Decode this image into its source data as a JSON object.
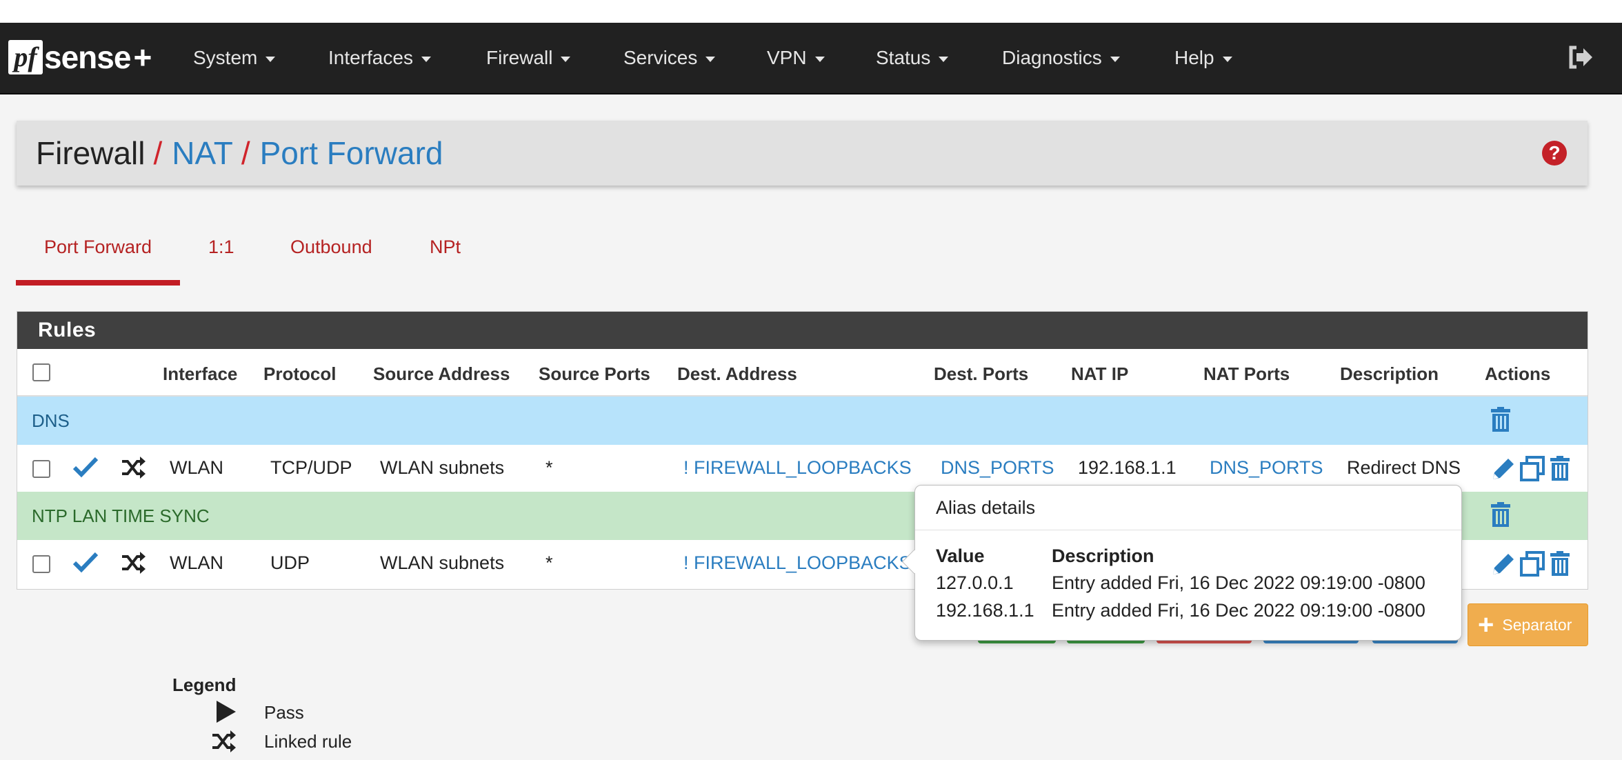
{
  "brand": {
    "pf": "pf",
    "name": "sense",
    "plus": "+"
  },
  "nav": {
    "items": [
      "System",
      "Interfaces",
      "Firewall",
      "Services",
      "VPN",
      "Status",
      "Diagnostics",
      "Help"
    ]
  },
  "breadcrumb": {
    "part1": "Firewall",
    "sep": "/",
    "part2": "NAT",
    "part3": "Port Forward",
    "help": "?"
  },
  "tabs": [
    "Port Forward",
    "1:1",
    "Outbound",
    "NPt"
  ],
  "rules": {
    "title": "Rules",
    "columns": [
      "Interface",
      "Protocol",
      "Source Address",
      "Source Ports",
      "Dest. Address",
      "Dest. Ports",
      "NAT IP",
      "NAT Ports",
      "Description",
      "Actions"
    ],
    "separators": [
      "DNS",
      "NTP LAN TIME SYNC"
    ],
    "rows": [
      {
        "interface": "WLAN",
        "protocol": "TCP/UDP",
        "source_address": "WLAN subnets",
        "source_ports": "*",
        "dest_address": "! FIREWALL_LOOPBACKS",
        "dest_ports": "DNS_PORTS",
        "nat_ip": "192.168.1.1",
        "nat_ports": "DNS_PORTS",
        "description": "Redirect DNS"
      },
      {
        "interface": "WLAN",
        "protocol": "UDP",
        "source_address": "WLAN subnets",
        "source_ports": "*",
        "dest_address": "! FIREWALL_LOOPBACKS"
      }
    ]
  },
  "popover": {
    "title": "Alias details",
    "col_value": "Value",
    "col_description": "Description",
    "entries": [
      {
        "value": "127.0.0.1",
        "description": "Entry added Fri, 16 Dec 2022 09:19:00 -0800"
      },
      {
        "value": "192.168.1.1",
        "description": "Entry added Fri, 16 Dec 2022 09:19:00 -0800"
      }
    ]
  },
  "buttons": {
    "separator": "Separator"
  },
  "legend": {
    "title": "Legend",
    "pass": "Pass",
    "linked": "Linked rule"
  },
  "colors": {
    "navbar": "#212121",
    "link": "#2a7dc0",
    "tab_active": "#c21d24",
    "dns_separator": "#b7e3fb",
    "ntp_separator": "#c5e6c8",
    "separator_button": "#f0ad4e"
  }
}
